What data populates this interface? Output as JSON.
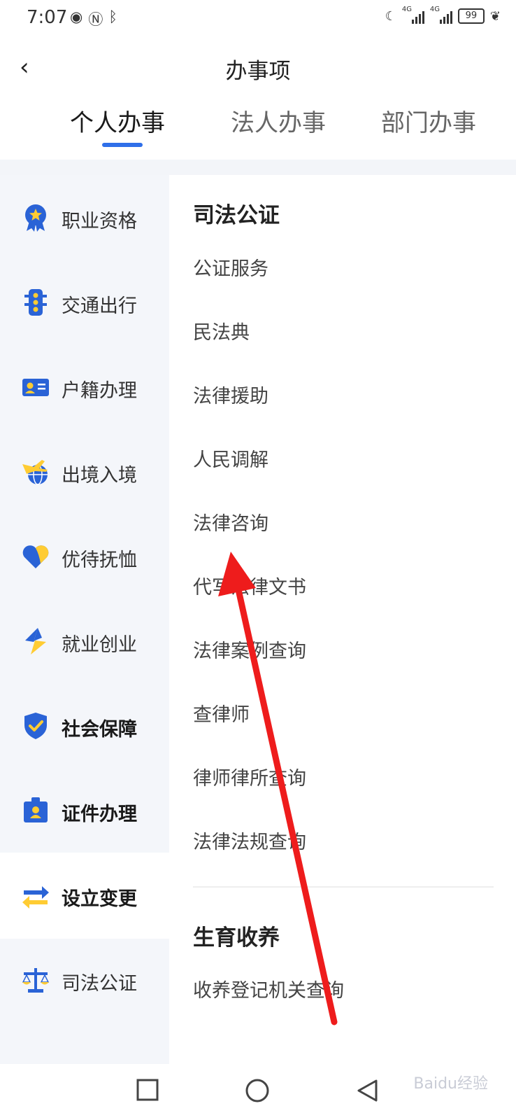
{
  "status_bar": {
    "time": "7:07",
    "battery": "99",
    "network": [
      "4G",
      "4G"
    ]
  },
  "header": {
    "back_icon": "chevron-left-icon",
    "title": "办事项"
  },
  "tabs": [
    {
      "label": "个人办事",
      "active": true
    },
    {
      "label": "法人办事",
      "active": false
    },
    {
      "label": "部门办事",
      "active": false
    }
  ],
  "sidebar": {
    "items": [
      {
        "label": "职业资格",
        "icon": "medal-icon"
      },
      {
        "label": "交通出行",
        "icon": "traffic-light-icon"
      },
      {
        "label": "户籍办理",
        "icon": "id-card-icon"
      },
      {
        "label": "出境入境",
        "icon": "plane-globe-icon"
      },
      {
        "label": "优待抚恤",
        "icon": "heart-icon"
      },
      {
        "label": "就业创业",
        "icon": "lightning-icon"
      },
      {
        "label": "社会保障",
        "icon": "shield-check-icon"
      },
      {
        "label": "证件办理",
        "icon": "badge-icon"
      },
      {
        "label": "设立变更",
        "icon": "swap-arrows-icon",
        "active": true
      },
      {
        "label": "司法公证",
        "icon": "scales-icon"
      }
    ]
  },
  "sections": [
    {
      "title": "司法公证",
      "items": [
        "公证服务",
        "民法典",
        "法律援助",
        "人民调解",
        "法律咨询",
        "代写法律文书",
        "法律案例查询",
        "查律师",
        "律师律所查询",
        "法律法规查询"
      ]
    },
    {
      "title": "生育收养",
      "items": [
        "收养登记机关查询"
      ]
    }
  ],
  "watermark": "Baidu经验",
  "colors": {
    "accent": "#2f6fe9",
    "icon_blue": "#2a63d6",
    "icon_yellow": "#ffcc33",
    "arrow": "#ee1c1c",
    "sidebar_bg": "#f4f6fa"
  }
}
